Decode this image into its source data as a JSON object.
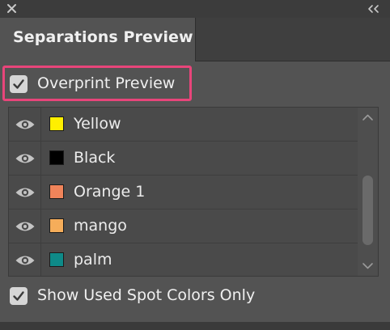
{
  "panel": {
    "tab_title": "Separations Preview",
    "overprint_preview": {
      "label": "Overprint Preview",
      "checked": true
    },
    "inks": [
      {
        "name": "Yellow",
        "color": "#ffef00",
        "visible": true
      },
      {
        "name": "Black",
        "color": "#000000",
        "visible": true
      },
      {
        "name": "Orange 1",
        "color": "#f0845a",
        "visible": true
      },
      {
        "name": "mango",
        "color": "#f5ad5a",
        "visible": true
      },
      {
        "name": "palm",
        "color": "#0e8a88",
        "visible": true
      }
    ],
    "show_used_spot_colors_only": {
      "label": "Show Used Spot Colors Only",
      "checked": true
    }
  },
  "icons": {
    "close": "close-icon",
    "collapse": "double-chevron-left-icon",
    "eye": "eye-icon",
    "check": "checkmark-icon"
  },
  "colors": {
    "highlight": "#e8457a",
    "panel_bg": "#535353",
    "list_bg": "#4a4a4a"
  }
}
